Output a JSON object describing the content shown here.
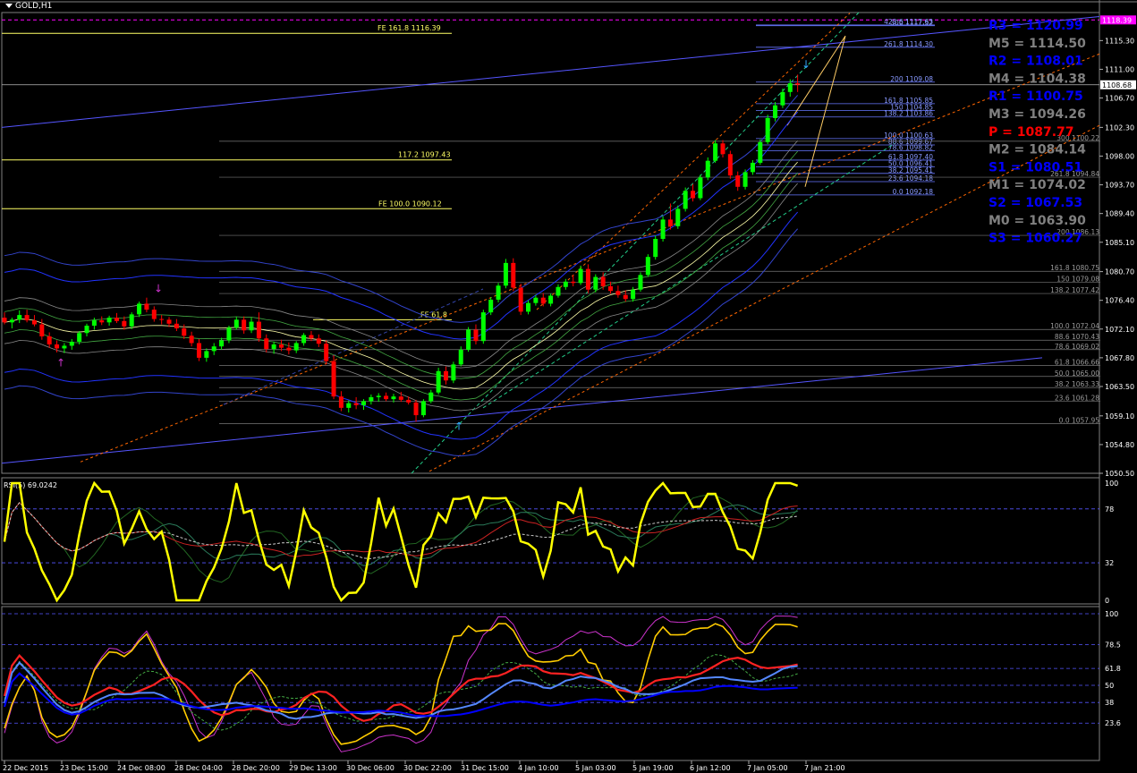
{
  "chart_data": {
    "type": "candlestick",
    "symbol": "GOLD,H1",
    "main": {
      "y_range": [
        1050.5,
        1119.5
      ],
      "price_ticks": [
        "1115.30",
        "1111.00",
        "1106.70",
        "1102.30",
        "1098.00",
        "1093.70",
        "1089.40",
        "1085.10",
        "1080.70",
        "1076.40",
        "1072.10",
        "1067.80",
        "1063.50",
        "1059.10",
        "1054.80",
        "1050.50"
      ],
      "last_price": "1108.68",
      "top_price": "1118.39",
      "x_labels": [
        "22 Dec 2015",
        "23 Dec 15:00",
        "24 Dec 08:00",
        "28 Dec 04:00",
        "28 Dec 20:00",
        "29 Dec 13:00",
        "30 Dec 06:00",
        "30 Dec 22:00",
        "31 Dec 15:00",
        "4 Jan 10:00",
        "5 Jan 03:00",
        "5 Jan 19:00",
        "6 Jan 12:00",
        "7 Jan 05:00",
        "7 Jan 21:00"
      ],
      "pivots": [
        {
          "label": "R3 = 1120.99",
          "color": "#0000ff"
        },
        {
          "label": "M5 = 1114.50",
          "color": "#808080"
        },
        {
          "label": "R2 = 1108.01",
          "color": "#0000ff"
        },
        {
          "label": "M4 = 1104.38",
          "color": "#808080"
        },
        {
          "label": "R1 = 1100.75",
          "color": "#0000ff"
        },
        {
          "label": "M3 = 1094.26",
          "color": "#808080"
        },
        {
          "label": "P  = 1087.77",
          "color": "#ff0000"
        },
        {
          "label": "M2 = 1084.14",
          "color": "#808080"
        },
        {
          "label": "S1 = 1080.51",
          "color": "#0000ff"
        },
        {
          "label": "M1 = 1074.02",
          "color": "#808080"
        },
        {
          "label": "S2 = 1067.53",
          "color": "#0000ff"
        },
        {
          "label": "M0 = 1063.90",
          "color": "#808080"
        },
        {
          "label": "S3 = 1060.27",
          "color": "#0000ff"
        }
      ],
      "fib_upper": [
        {
          "label": "423.6 1117.63",
          "price": 1117.63
        },
        {
          "label": "300 1117.52",
          "price": 1117.52
        },
        {
          "label": "261.8 1114.30",
          "price": 1114.3
        },
        {
          "label": "200 1109.08",
          "price": 1109.08
        },
        {
          "label": "161.8 1105.85",
          "price": 1105.85
        },
        {
          "label": "150 1104.85",
          "price": 1104.85
        },
        {
          "label": "138.2 1103.86",
          "price": 1103.86
        },
        {
          "label": "100.0 1100.63",
          "price": 1100.63
        },
        {
          "label": "88.6 1099.67",
          "price": 1099.67
        },
        {
          "label": "78.6 1098.82",
          "price": 1098.82
        },
        {
          "label": "61.8 1097.40",
          "price": 1097.4
        },
        {
          "label": "50.0 1096.41",
          "price": 1096.41
        },
        {
          "label": "38.2 1095.41",
          "price": 1095.41
        },
        {
          "label": "23.6 1094.18",
          "price": 1094.18
        },
        {
          "label": "0.0 1092.18",
          "price": 1092.18
        }
      ],
      "fib_lower": [
        {
          "label": "300 1100.22",
          "price": 1100.22
        },
        {
          "label": "261.8 1094.84",
          "price": 1094.84
        },
        {
          "label": "200 1086.13",
          "price": 1086.13
        },
        {
          "label": "161.8 1080.75",
          "price": 1080.75
        },
        {
          "label": "150 1079.08",
          "price": 1079.08
        },
        {
          "label": "138.2 1077.42",
          "price": 1077.42
        },
        {
          "label": "100.0 1072.04",
          "price": 1072.04
        },
        {
          "label": "88.6 1070.43",
          "price": 1070.43
        },
        {
          "label": "78.6 1069.02",
          "price": 1069.02
        },
        {
          "label": "61.8 1066.66",
          "price": 1066.66
        },
        {
          "label": "50.0 1065.00",
          "price": 1065.0
        },
        {
          "label": "38.2 1063.33",
          "price": 1063.33
        },
        {
          "label": "23.6 1061.28",
          "price": 1061.28
        },
        {
          "label": "0.0 1057.95",
          "price": 1057.95
        }
      ],
      "fe_levels": [
        {
          "label": "FE 161.8    1116.39",
          "price": 1116.39
        },
        {
          "label": "117.2 1097.43",
          "price": 1097.43
        },
        {
          "label": "FE 100.0 1090.12",
          "price": 1090.12
        },
        {
          "label": "FE 61.8",
          "price": 1073.5
        }
      ],
      "candles": [
        [
          1073.8,
          1074.6,
          1072.8,
          1073.1
        ],
        [
          1073.1,
          1073.8,
          1072.2,
          1073.5
        ],
        [
          1073.5,
          1074.9,
          1073.0,
          1074.2
        ],
        [
          1074.2,
          1075.0,
          1073.1,
          1073.4
        ],
        [
          1073.4,
          1074.2,
          1072.5,
          1072.8
        ],
        [
          1072.8,
          1073.6,
          1070.5,
          1071.0
        ],
        [
          1071.0,
          1071.6,
          1069.3,
          1069.8
        ],
        [
          1069.8,
          1070.4,
          1068.6,
          1069.2
        ],
        [
          1069.2,
          1070.0,
          1068.5,
          1069.6
        ],
        [
          1069.6,
          1070.6,
          1069.0,
          1070.2
        ],
        [
          1070.2,
          1071.8,
          1069.8,
          1071.5
        ],
        [
          1071.5,
          1072.9,
          1071.0,
          1072.6
        ],
        [
          1072.6,
          1073.8,
          1072.0,
          1073.4
        ],
        [
          1073.4,
          1074.0,
          1072.7,
          1073.1
        ],
        [
          1073.1,
          1074.1,
          1072.6,
          1073.8
        ],
        [
          1073.8,
          1074.5,
          1073.0,
          1073.3
        ],
        [
          1073.3,
          1074.0,
          1072.0,
          1072.5
        ],
        [
          1072.5,
          1074.6,
          1072.1,
          1074.3
        ],
        [
          1074.3,
          1076.2,
          1073.9,
          1075.9
        ],
        [
          1075.9,
          1076.8,
          1074.6,
          1075.0
        ],
        [
          1075.0,
          1075.5,
          1073.2,
          1073.6
        ],
        [
          1073.6,
          1074.2,
          1072.8,
          1073.5
        ],
        [
          1073.5,
          1073.9,
          1072.4,
          1072.9
        ],
        [
          1072.9,
          1073.6,
          1071.8,
          1072.2
        ],
        [
          1072.2,
          1072.8,
          1070.6,
          1071.1
        ],
        [
          1071.1,
          1071.7,
          1069.5,
          1070.0
        ],
        [
          1070.0,
          1070.6,
          1067.3,
          1067.8
        ],
        [
          1067.8,
          1069.2,
          1067.2,
          1068.8
        ],
        [
          1068.8,
          1070.0,
          1068.2,
          1069.5
        ],
        [
          1069.5,
          1070.8,
          1069.0,
          1070.4
        ],
        [
          1070.4,
          1072.6,
          1070.0,
          1072.3
        ],
        [
          1072.3,
          1073.9,
          1072.0,
          1073.5
        ],
        [
          1073.5,
          1074.0,
          1071.4,
          1071.9
        ],
        [
          1071.9,
          1073.8,
          1071.5,
          1073.2
        ],
        [
          1073.2,
          1074.6,
          1070.2,
          1070.7
        ],
        [
          1070.7,
          1071.3,
          1068.6,
          1069.1
        ],
        [
          1069.1,
          1070.2,
          1068.4,
          1069.8
        ],
        [
          1069.8,
          1070.5,
          1068.8,
          1069.3
        ],
        [
          1069.3,
          1070.1,
          1068.3,
          1068.9
        ],
        [
          1068.9,
          1070.3,
          1068.5,
          1070.0
        ],
        [
          1070.0,
          1071.5,
          1069.6,
          1071.2
        ],
        [
          1071.2,
          1071.8,
          1070.3,
          1070.7
        ],
        [
          1070.7,
          1071.3,
          1069.4,
          1069.9
        ],
        [
          1069.9,
          1070.4,
          1066.8,
          1067.3
        ],
        [
          1067.3,
          1068.2,
          1061.6,
          1062.0
        ],
        [
          1062.0,
          1062.8,
          1059.8,
          1060.3
        ],
        [
          1060.3,
          1061.4,
          1059.6,
          1061.0
        ],
        [
          1061.0,
          1061.9,
          1060.1,
          1060.7
        ],
        [
          1060.7,
          1061.6,
          1060.0,
          1061.3
        ],
        [
          1061.3,
          1062.3,
          1060.8,
          1061.9
        ],
        [
          1061.9,
          1062.5,
          1061.2,
          1062.1
        ],
        [
          1062.1,
          1062.6,
          1061.3,
          1061.6
        ],
        [
          1061.6,
          1062.4,
          1061.1,
          1062.0
        ],
        [
          1062.0,
          1062.7,
          1061.2,
          1061.5
        ],
        [
          1061.5,
          1062.0,
          1060.8,
          1061.1
        ],
        [
          1061.1,
          1061.5,
          1058.2,
          1059.2
        ],
        [
          1059.2,
          1061.6,
          1058.9,
          1061.3
        ],
        [
          1061.3,
          1063.0,
          1061.0,
          1062.6
        ],
        [
          1062.6,
          1066.3,
          1062.3,
          1065.8
        ],
        [
          1065.8,
          1066.5,
          1063.8,
          1064.4
        ],
        [
          1064.4,
          1067.2,
          1064.0,
          1066.8
        ],
        [
          1066.8,
          1069.5,
          1066.5,
          1069.0
        ],
        [
          1069.0,
          1072.4,
          1068.7,
          1072.0
        ],
        [
          1072.0,
          1072.8,
          1069.8,
          1070.3
        ],
        [
          1070.3,
          1075.0,
          1069.9,
          1074.6
        ],
        [
          1074.6,
          1076.9,
          1074.2,
          1076.5
        ],
        [
          1076.5,
          1079.0,
          1076.1,
          1078.6
        ],
        [
          1078.6,
          1082.6,
          1078.2,
          1082.0
        ],
        [
          1082.0,
          1082.7,
          1077.8,
          1078.3
        ],
        [
          1078.3,
          1078.9,
          1074.2,
          1074.7
        ],
        [
          1074.7,
          1076.4,
          1074.3,
          1076.0
        ],
        [
          1076.0,
          1077.2,
          1075.6,
          1076.8
        ],
        [
          1076.8,
          1077.5,
          1075.5,
          1075.9
        ],
        [
          1075.9,
          1077.4,
          1075.5,
          1077.1
        ],
        [
          1077.1,
          1078.8,
          1076.8,
          1078.4
        ],
        [
          1078.4,
          1079.6,
          1078.0,
          1079.2
        ],
        [
          1079.2,
          1080.2,
          1078.5,
          1079.0
        ],
        [
          1079.0,
          1081.6,
          1078.7,
          1081.1
        ],
        [
          1081.1,
          1081.8,
          1077.5,
          1078.0
        ],
        [
          1078.0,
          1080.3,
          1077.6,
          1079.9
        ],
        [
          1079.9,
          1080.6,
          1078.0,
          1078.5
        ],
        [
          1078.5,
          1079.2,
          1077.4,
          1077.8
        ],
        [
          1077.8,
          1078.6,
          1076.8,
          1077.2
        ],
        [
          1077.2,
          1077.9,
          1076.2,
          1076.6
        ],
        [
          1076.6,
          1078.4,
          1076.2,
          1078.0
        ],
        [
          1078.0,
          1080.6,
          1077.7,
          1080.2
        ],
        [
          1080.2,
          1083.3,
          1079.9,
          1082.9
        ],
        [
          1082.9,
          1086.1,
          1082.5,
          1085.6
        ],
        [
          1085.6,
          1089.0,
          1085.2,
          1088.5
        ],
        [
          1088.5,
          1090.9,
          1087.0,
          1087.5
        ],
        [
          1087.5,
          1090.6,
          1087.1,
          1090.1
        ],
        [
          1090.1,
          1093.3,
          1089.7,
          1092.8
        ],
        [
          1092.8,
          1093.8,
          1091.2,
          1091.7
        ],
        [
          1091.7,
          1095.2,
          1091.4,
          1094.8
        ],
        [
          1094.8,
          1097.8,
          1094.4,
          1097.3
        ],
        [
          1097.3,
          1100.4,
          1097.0,
          1099.9
        ],
        [
          1099.9,
          1100.4,
          1097.8,
          1098.3
        ],
        [
          1098.3,
          1098.8,
          1094.6,
          1095.1
        ],
        [
          1095.1,
          1095.7,
          1092.8,
          1093.4
        ],
        [
          1093.4,
          1096.0,
          1093.0,
          1095.6
        ],
        [
          1095.6,
          1097.4,
          1095.2,
          1097.0
        ],
        [
          1097.0,
          1100.5,
          1096.7,
          1100.1
        ],
        [
          1100.1,
          1104.2,
          1099.8,
          1103.7
        ],
        [
          1103.7,
          1106.1,
          1103.2,
          1105.6
        ],
        [
          1105.6,
          1108.1,
          1105.2,
          1107.6
        ],
        [
          1107.6,
          1109.5,
          1106.9,
          1108.9
        ],
        [
          1108.9,
          1110.2,
          1107.6,
          1108.7
        ]
      ]
    },
    "rsi": {
      "label": "RSI(5) 69.0242",
      "levels": [
        "100",
        "78",
        "32",
        "0"
      ],
      "y_range": [
        0,
        100
      ]
    },
    "osc": {
      "levels": [
        "100",
        "78.5",
        "61.8",
        "50",
        "38",
        "23.6"
      ],
      "y_range": [
        0,
        100
      ]
    },
    "colors": {
      "bull": "#00ff00",
      "bear": "#ff0000",
      "grid": "#404040",
      "channel_orange": "#ff6600",
      "channel_green": "#00ff99",
      "envelope_blue": "#0000ff",
      "rsi": "#ffff00"
    }
  }
}
